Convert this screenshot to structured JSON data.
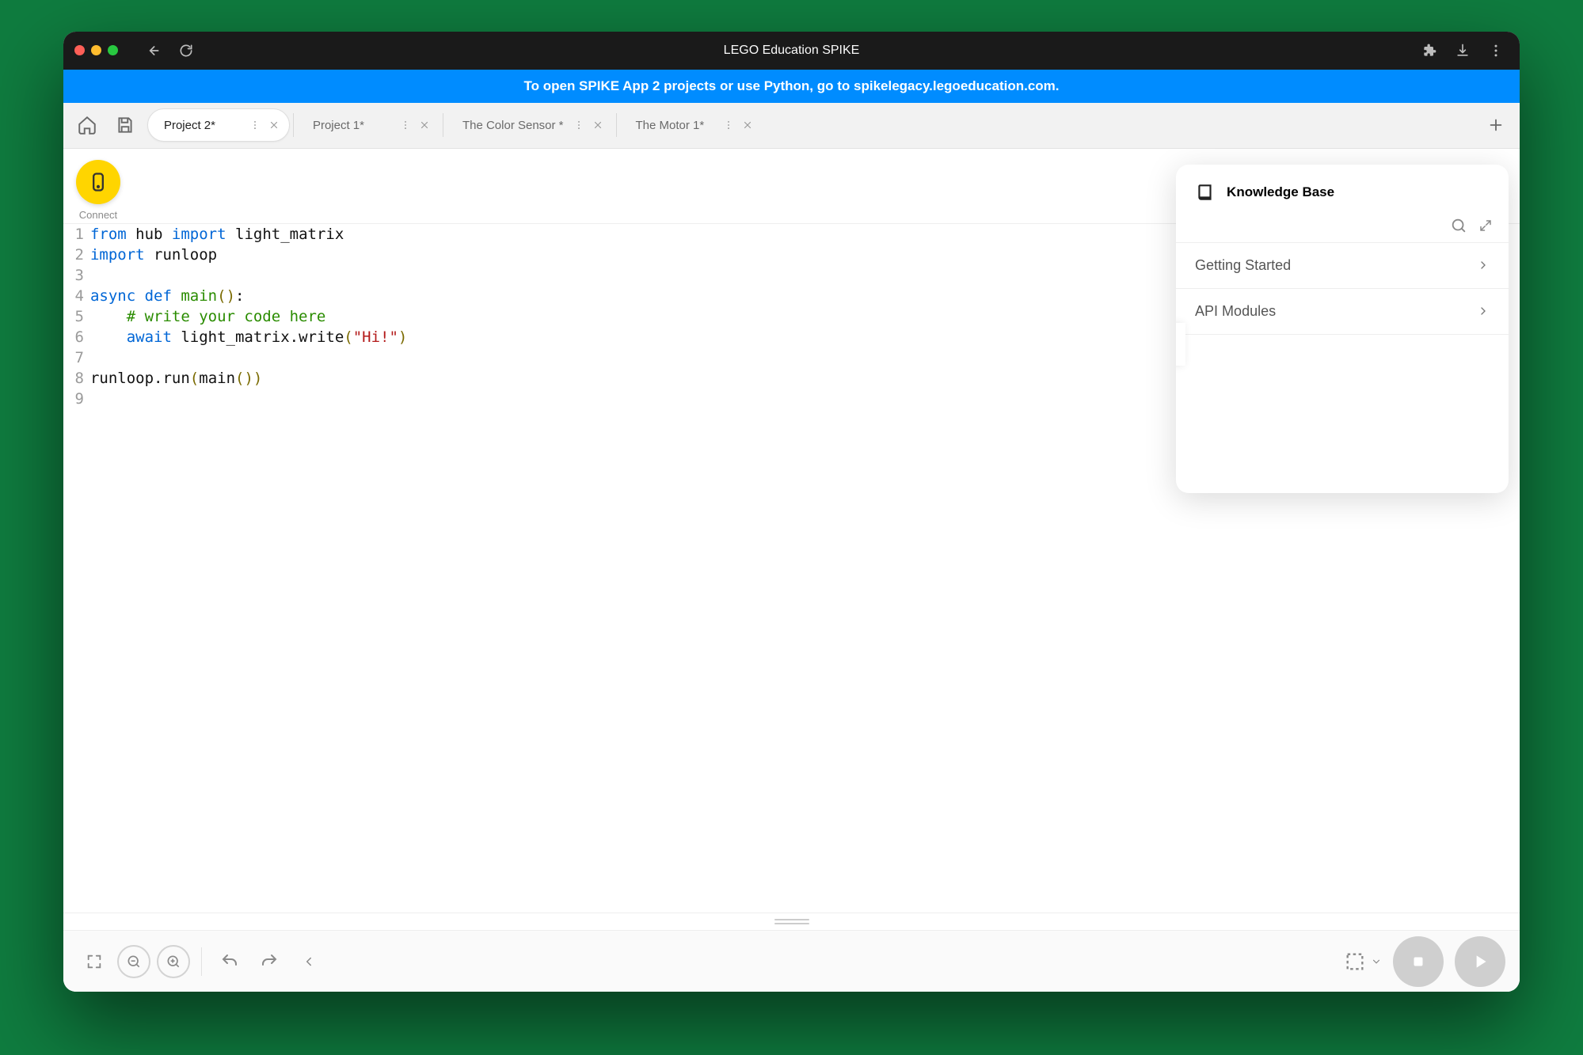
{
  "titlebar": {
    "title": "LEGO Education SPIKE"
  },
  "banner": {
    "text": "To open SPIKE App 2 projects or use Python, go to spikelegacy.legoeducation.com."
  },
  "tabs": [
    {
      "label": "Project 2*",
      "active": true
    },
    {
      "label": "Project 1*",
      "active": false
    },
    {
      "label": "The Color Sensor *",
      "active": false
    },
    {
      "label": "The Motor 1*",
      "active": false
    }
  ],
  "connect": {
    "label": "Connect"
  },
  "code": {
    "lines": [
      {
        "n": "1",
        "tokens": [
          {
            "t": "from ",
            "c": "kw"
          },
          {
            "t": "hub ",
            "c": "id"
          },
          {
            "t": "import ",
            "c": "kw"
          },
          {
            "t": "light_matrix",
            "c": "id"
          }
        ]
      },
      {
        "n": "2",
        "tokens": [
          {
            "t": "import ",
            "c": "kw"
          },
          {
            "t": "runloop",
            "c": "id"
          }
        ]
      },
      {
        "n": "3",
        "tokens": []
      },
      {
        "n": "4",
        "tokens": [
          {
            "t": "async ",
            "c": "kw"
          },
          {
            "t": "def ",
            "c": "kw"
          },
          {
            "t": "main",
            "c": "fn"
          },
          {
            "t": "()",
            "c": "op"
          },
          {
            "t": ":",
            "c": "id"
          }
        ]
      },
      {
        "n": "5",
        "tokens": [
          {
            "t": "    ",
            "c": "id"
          },
          {
            "t": "# write your code here",
            "c": "cm"
          }
        ]
      },
      {
        "n": "6",
        "tokens": [
          {
            "t": "    ",
            "c": "id"
          },
          {
            "t": "await ",
            "c": "kw"
          },
          {
            "t": "light_matrix.write",
            "c": "id"
          },
          {
            "t": "(",
            "c": "op"
          },
          {
            "t": "\"Hi!\"",
            "c": "st"
          },
          {
            "t": ")",
            "c": "op"
          }
        ]
      },
      {
        "n": "7",
        "tokens": []
      },
      {
        "n": "8",
        "tokens": [
          {
            "t": "runloop.run",
            "c": "id"
          },
          {
            "t": "(",
            "c": "op"
          },
          {
            "t": "main",
            "c": "id"
          },
          {
            "t": "()",
            "c": "op"
          },
          {
            "t": ")",
            "c": "op"
          }
        ]
      },
      {
        "n": "9",
        "tokens": []
      }
    ]
  },
  "kb": {
    "title": "Knowledge Base",
    "items": [
      "Getting Started",
      "API Modules"
    ]
  }
}
